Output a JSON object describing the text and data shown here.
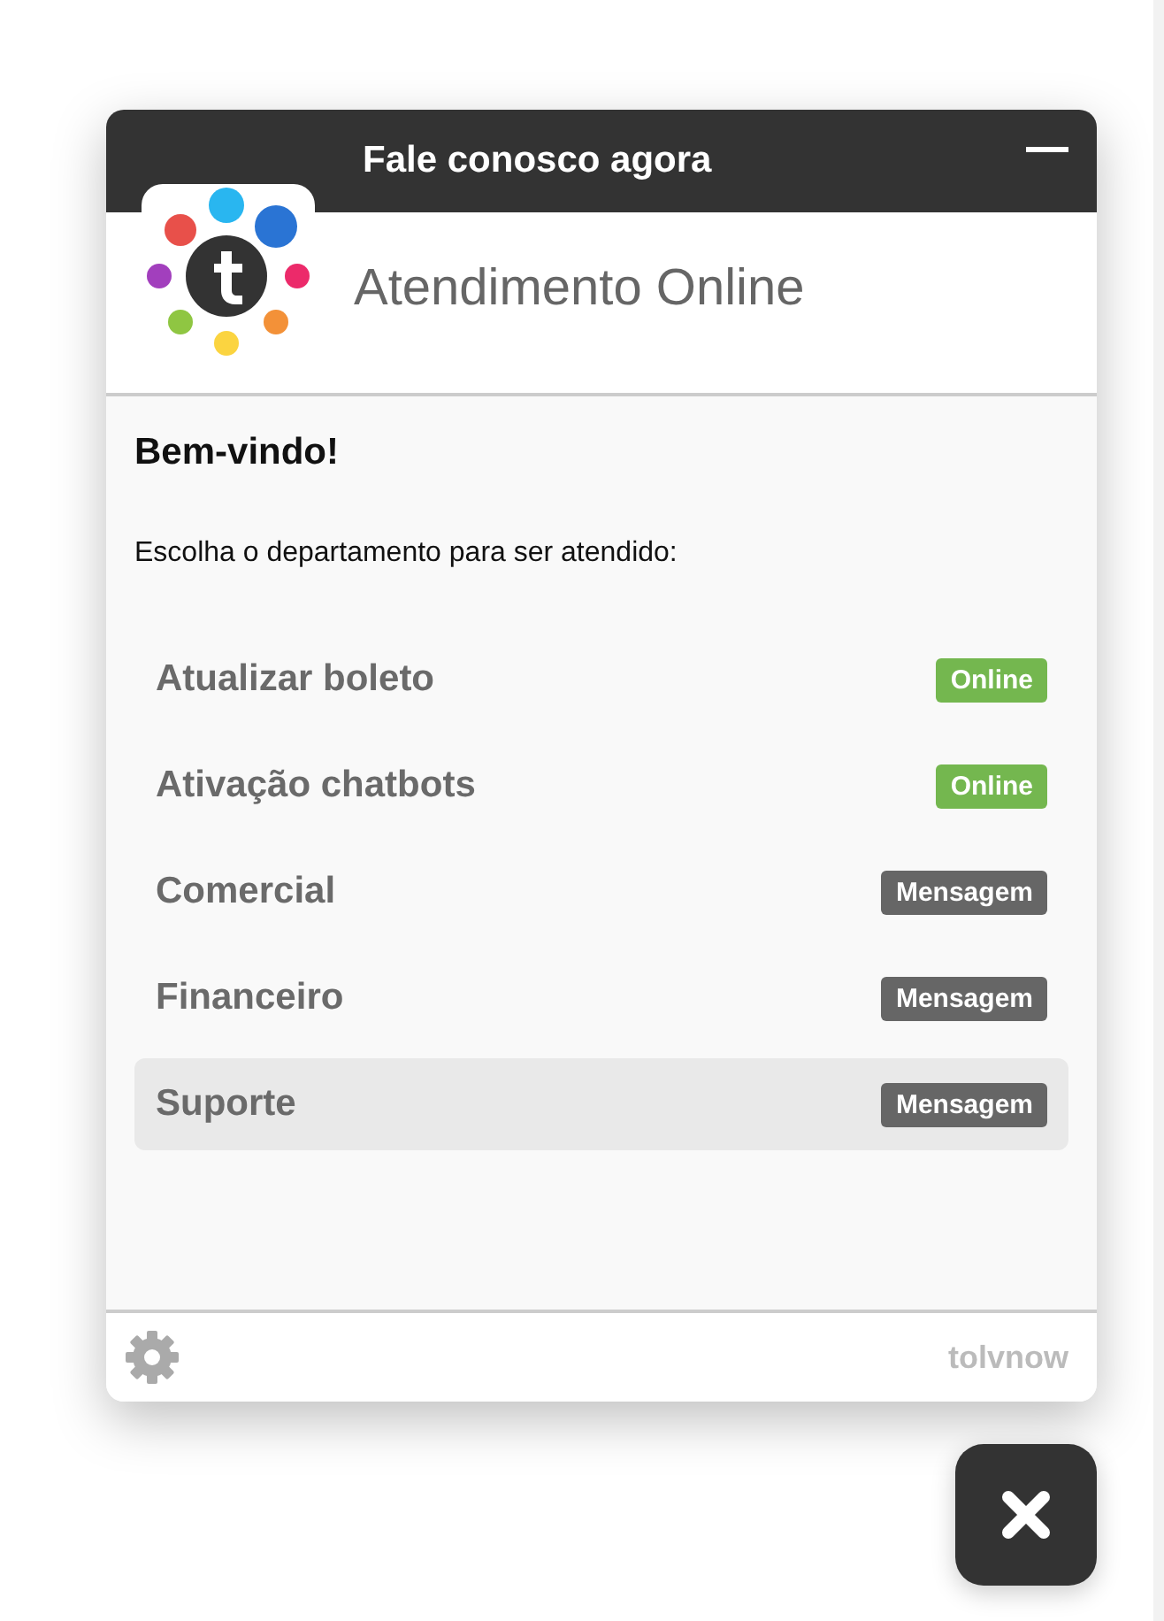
{
  "window": {
    "title": "Fale conosco agora"
  },
  "brand": {
    "title": "Atendimento Online"
  },
  "welcome": {
    "heading": "Bem-vindo!",
    "prompt": "Escolha o departamento para ser atendido:"
  },
  "departments": [
    {
      "name": "Atualizar boleto",
      "status": "Online",
      "kind": "online",
      "selected": false
    },
    {
      "name": "Ativação chatbots",
      "status": "Online",
      "kind": "online",
      "selected": false
    },
    {
      "name": "Comercial",
      "status": "Mensagem",
      "kind": "message",
      "selected": false
    },
    {
      "name": "Financeiro",
      "status": "Mensagem",
      "kind": "message",
      "selected": false
    },
    {
      "name": "Suporte",
      "status": "Mensagem",
      "kind": "message",
      "selected": true
    }
  ],
  "footer": {
    "brand": "tolvnow"
  }
}
